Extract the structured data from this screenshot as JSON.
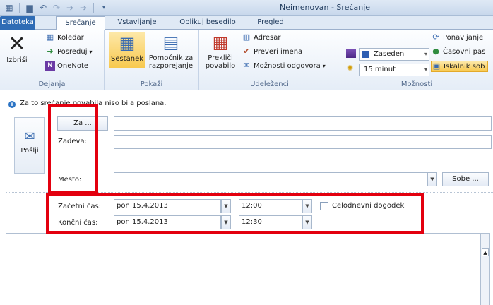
{
  "window": {
    "title": "Neimenovan - Srečanje"
  },
  "tabs": [
    {
      "label": "Datoteka"
    },
    {
      "label": "Srečanje"
    },
    {
      "label": "Vstavljanje"
    },
    {
      "label": "Oblikuj besedilo"
    },
    {
      "label": "Pregled"
    }
  ],
  "ribbon": {
    "dejanja": {
      "label": "Dejanja",
      "delete": "Izbriši",
      "calendar": "Koledar",
      "forward": "Posreduj",
      "onenote": "OneNote"
    },
    "pokazi": {
      "label": "Pokaži",
      "meeting": "Sestanek",
      "assistant_line1": "Pomočnik za",
      "assistant_line2": "razporejanje"
    },
    "udelezenci": {
      "label": "Udeleženci",
      "cancel_line1": "Prekliči",
      "cancel_line2": "povabilo",
      "address_book": "Adresar",
      "check_names": "Preveri imena",
      "response_options": "Možnosti odgovora"
    },
    "moznosti": {
      "label": "Možnosti",
      "show_as": "Zaseden",
      "reminder": "15 minut",
      "recurrence": "Ponavljanje",
      "time_zones": "Časovni pas",
      "room_finder": "Iskalnik sob"
    }
  },
  "infobar": {
    "text": "Za to srečanje povabila niso bila poslana."
  },
  "form": {
    "send": "Pošlji",
    "to_button": "Za ...",
    "to_value": "",
    "subject_label": "Zadeva:",
    "subject_value": "",
    "location_label": "Mesto:",
    "location_value": "",
    "rooms_button": "Sobe ...",
    "start_label": "Začetni čas:",
    "start_date": "pon 15.4.2013",
    "start_time": "12:00",
    "end_label": "Končni čas:",
    "end_date": "pon 15.4.2013",
    "end_time": "12:30",
    "all_day": "Celodnevni dogodek",
    "all_day_checked": false
  },
  "colors": {
    "annotation": "#e3000f",
    "file_tab": "#2f6cb5",
    "meeting_active": "#f8c94f"
  }
}
